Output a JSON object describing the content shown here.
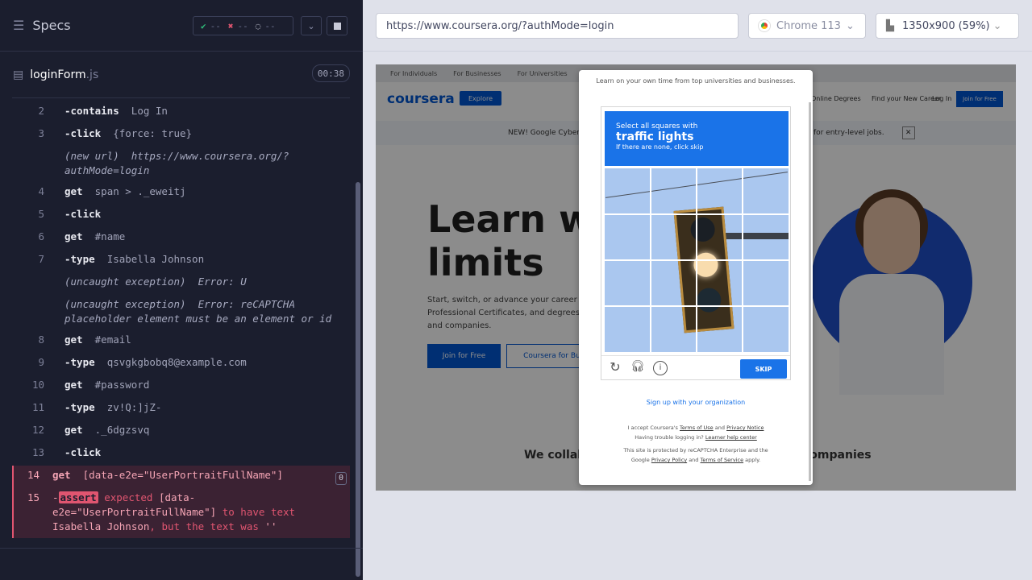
{
  "left": {
    "title": "Specs",
    "stats": {
      "passed": "--",
      "failed": "--",
      "pending": "--"
    },
    "file": {
      "name": "loginForm",
      "ext": ".js",
      "timer": "00:38"
    },
    "commands": [
      {
        "num": "2",
        "cmd": "-contains",
        "arg": "Log In"
      },
      {
        "num": "3",
        "cmd": "-click",
        "arg": "{force: true}"
      },
      {
        "num": "",
        "info": "(new url)  https://www.coursera.org/?authMode=login"
      },
      {
        "num": "4",
        "cmd": "get",
        "arg": "span > ._eweitj"
      },
      {
        "num": "5",
        "cmd": "-click",
        "arg": ""
      },
      {
        "num": "6",
        "cmd": "get",
        "arg": "#name"
      },
      {
        "num": "7",
        "cmd": "-type",
        "arg": "Isabella Johnson"
      },
      {
        "num": "",
        "info": "(uncaught exception)  Error: U"
      },
      {
        "num": "",
        "info": "(uncaught exception)  Error: reCAPTCHA placeholder element must be an element or id"
      },
      {
        "num": "8",
        "cmd": "get",
        "arg": "#email"
      },
      {
        "num": "9",
        "cmd": "-type",
        "arg": "qsvgkgbobq8@example.com"
      },
      {
        "num": "10",
        "cmd": "get",
        "arg": "#password"
      },
      {
        "num": "11",
        "cmd": "-type",
        "arg": "zv!Q:]jZ-"
      },
      {
        "num": "12",
        "cmd": "get",
        "arg": "._6dgzsvq"
      },
      {
        "num": "13",
        "cmd": "-click",
        "arg": ""
      }
    ],
    "fail": {
      "num14": "14",
      "cmd14": "get",
      "arg14": "[data-e2e=\"UserPortraitFullName\"]",
      "badge": "0",
      "num15": "15",
      "assert": "assert",
      "expected": "expected",
      "selector": "[data-e2e=\"UserPortraitFullName\"]",
      "to_have": "to have text",
      "value": "Isabella Johnson",
      "but": ", but the text was",
      "actual": "''"
    }
  },
  "right": {
    "url": "https://www.coursera.org/?authMode=login",
    "browser": "Chrome 113",
    "viewport": "1350x900",
    "zoom": "(59%)"
  },
  "aut": {
    "tabs": [
      "For Individuals",
      "For Businesses",
      "For Universities"
    ],
    "logo": "coursera",
    "explore": "Explore",
    "degrees": "Online Degrees",
    "career": "Find your New Career",
    "login": "Log In",
    "join": "Join for Free",
    "banner": "NEW! Google Cyber",
    "banner_end": "for entry-level jobs.",
    "hero": [
      "Learn wit",
      "limits"
    ],
    "hero_p": "Start, switch, or advance your career w Professional Certificates, and degrees f and companies.",
    "btn_join": "Join for Free",
    "btn_business": "Coursera for Busi",
    "collab": "We collab",
    "collab2": "companies",
    "modal": {
      "sub": "Learn on your own time from top universities and businesses.",
      "cap_a": "Select all squares with",
      "cap_b": "traffic lights",
      "cap_c": "If there are none, click skip",
      "skip": "SKIP",
      "org": "Sign up with your organization",
      "t1": "I accept Coursera's",
      "tou": "Terms of Use",
      "and": "and",
      "pn": "Privacy Notice",
      "t2": "Having trouble logging in?",
      "lhc": "Learner help center",
      "t3": "This site is protected by reCAPTCHA Enterprise and the Google",
      "pp": "Privacy Policy",
      "tos": "Terms of Service",
      "apply": "apply."
    }
  }
}
